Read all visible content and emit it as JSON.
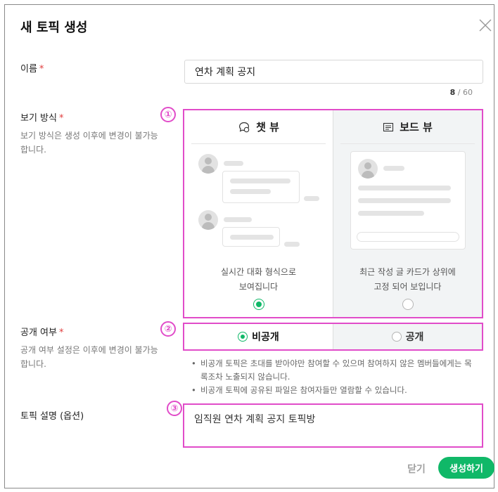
{
  "dialog": {
    "title": "새 토픽 생성",
    "close_icon": "close-icon"
  },
  "name_field": {
    "label": "이름",
    "required_mark": "*",
    "value": "연차 계획 공지",
    "count_current": "8",
    "count_sep": " / ",
    "count_max": "60"
  },
  "view_mode": {
    "label": "보기 방식",
    "required_mark": "*",
    "help": "보기 방식은 생성 이후에 변경이 불가능합니다.",
    "marker": "①",
    "options": [
      {
        "label": "챗 뷰",
        "icon": "chat-bubble-icon",
        "desc_line1": "실시간 대화 형식으로",
        "desc_line2": "보여집니다",
        "selected": true
      },
      {
        "label": "보드 뷰",
        "icon": "board-list-icon",
        "desc_line1": "최근 작성 글 카드가 상위에",
        "desc_line2": "고정 되어 보입니다",
        "selected": false
      }
    ]
  },
  "visibility": {
    "label": "공개 여부",
    "required_mark": "*",
    "help": "공개 여부 설정은 이후에 변경이 불가능합니다.",
    "marker": "②",
    "options": [
      {
        "label": "비공개",
        "selected": true
      },
      {
        "label": "공개",
        "selected": false
      }
    ],
    "notes": [
      "비공개 토픽은 초대를 받아야만 참여할 수 있으며 참여하지 않은 멤버들에게는 목록조차 노출되지 않습니다.",
      "비공개 토픽에 공유된 파일은 참여자들만 열람할 수 있습니다."
    ]
  },
  "description": {
    "label": "토픽 설명 (옵션)",
    "marker": "③",
    "value": "임직원 연차 계획 공지 토픽방"
  },
  "footer": {
    "close_label": "닫기",
    "create_label": "생성하기"
  },
  "colors": {
    "accent_green": "#10b868",
    "highlight_magenta": "#e14cc9",
    "required_red": "#e03c3c"
  }
}
